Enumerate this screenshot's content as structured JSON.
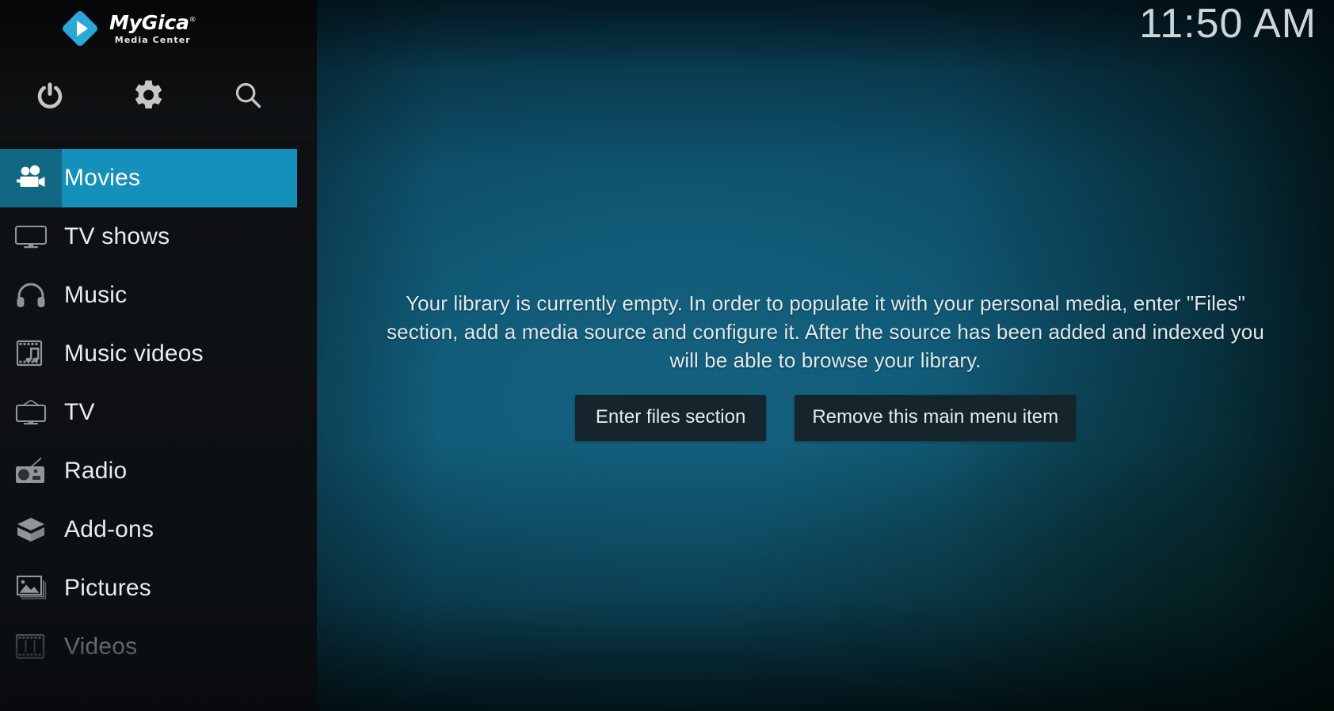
{
  "brand": {
    "name": "MyGica",
    "registered": "®",
    "subtitle": "Media Center",
    "logo_color": "#2aa8d8"
  },
  "header": {
    "clock": "11:50 AM",
    "icons": [
      {
        "name": "power-icon",
        "label": "Power"
      },
      {
        "name": "settings-icon",
        "label": "Settings"
      },
      {
        "name": "search-icon",
        "label": "Search"
      }
    ]
  },
  "sidebar": {
    "accent_color": "#1590bb",
    "accent_icon_color": "#106882",
    "background_color": "#0e1114",
    "items": [
      {
        "label": "Movies",
        "icon": "movie-camera-icon",
        "state": "active"
      },
      {
        "label": "TV shows",
        "icon": "television-icon",
        "state": "normal"
      },
      {
        "label": "Music",
        "icon": "headphones-icon",
        "state": "normal"
      },
      {
        "label": "Music videos",
        "icon": "music-film-icon",
        "state": "normal"
      },
      {
        "label": "TV",
        "icon": "retro-tv-icon",
        "state": "normal"
      },
      {
        "label": "Radio",
        "icon": "radio-icon",
        "state": "normal"
      },
      {
        "label": "Add-ons",
        "icon": "open-box-icon",
        "state": "normal"
      },
      {
        "label": "Pictures",
        "icon": "pictures-icon",
        "state": "normal"
      },
      {
        "label": "Videos",
        "icon": "film-strip-icon",
        "state": "dim"
      }
    ]
  },
  "main": {
    "empty_message": "Your library is currently empty. In order to populate it with your personal media, enter \"Files\" section, add a media source and configure it. After the source has been added and indexed you will be able to browse your library.",
    "buttons": [
      {
        "label": "Enter files section"
      },
      {
        "label": "Remove this main menu item"
      }
    ]
  }
}
